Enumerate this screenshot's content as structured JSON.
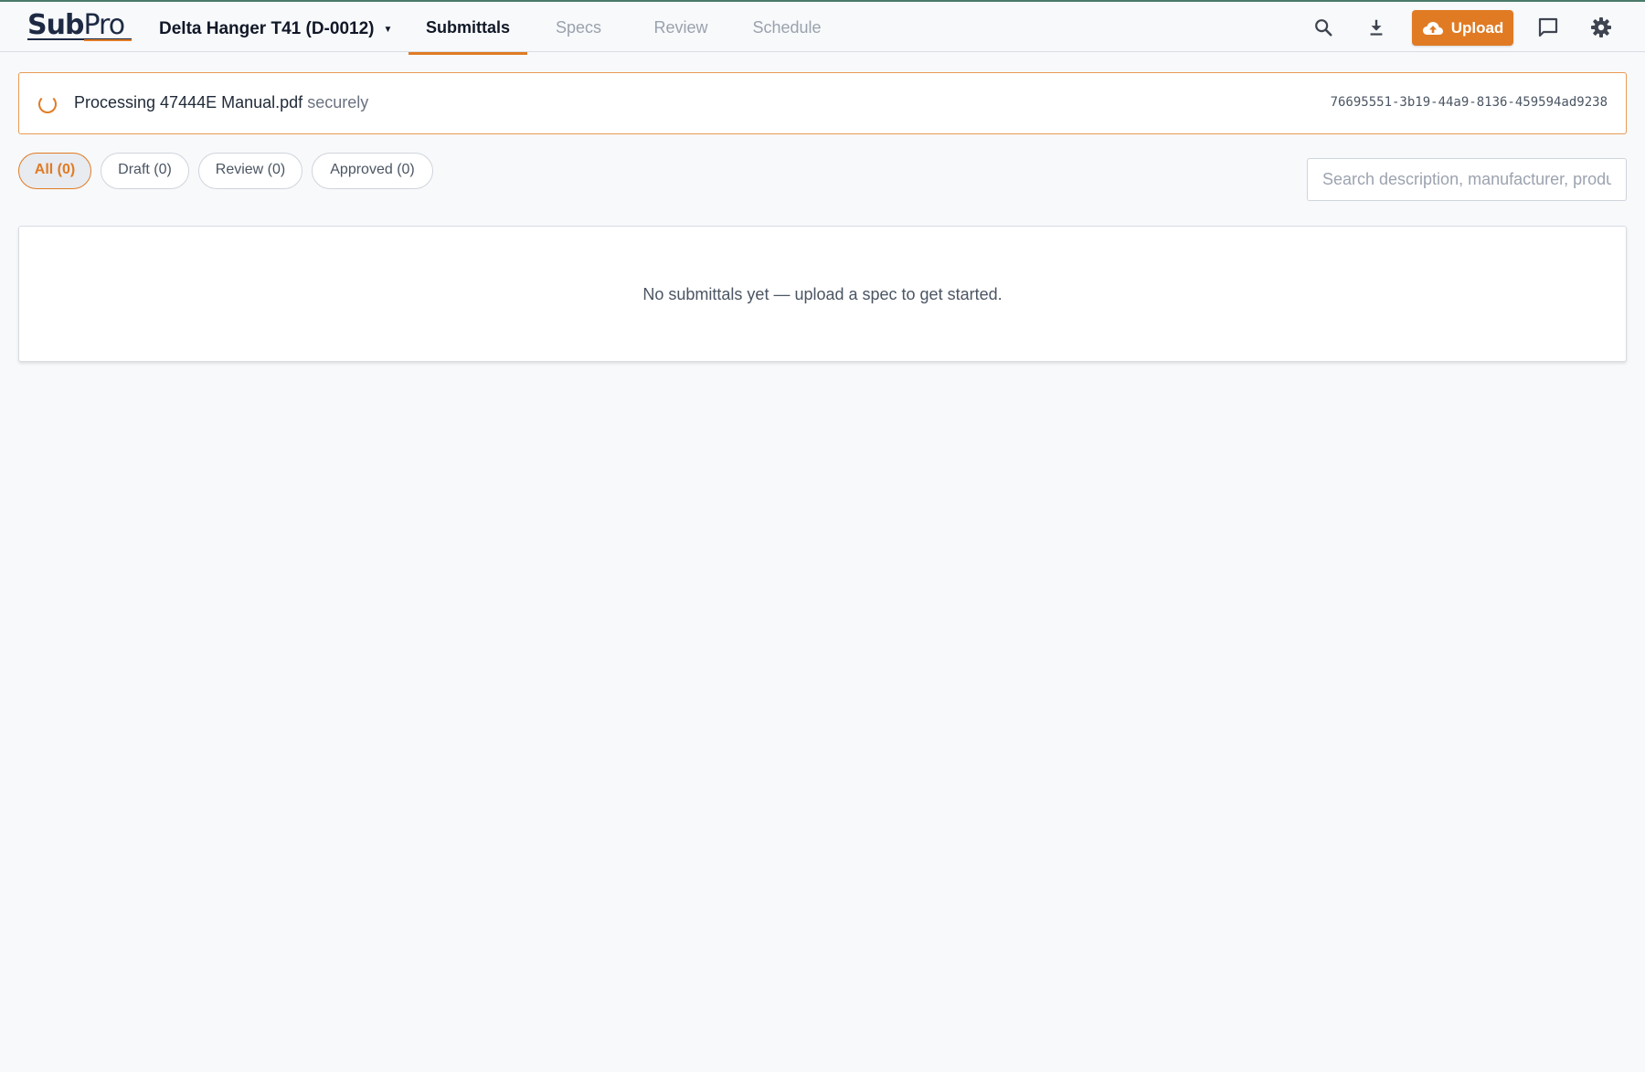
{
  "app": {
    "logo_sub": "Sub",
    "logo_pro": "Pro",
    "project": "Delta Hanger T41 (D-0012)"
  },
  "tabs": [
    {
      "label": "Submittals",
      "active": true
    },
    {
      "label": "Specs",
      "active": false
    },
    {
      "label": "Review",
      "active": false
    },
    {
      "label": "Schedule",
      "active": false
    }
  ],
  "toolbar": {
    "upload_label": "Upload",
    "icons": [
      "search-icon",
      "download-icon",
      "cloud-upload-icon",
      "chat-icon",
      "gear-icon"
    ]
  },
  "banner": {
    "prefix": "Processing 47444E Manual.pdf",
    "suffix": "securely",
    "job_id": "76695551-3b19-44a9-8136-459594ad9238"
  },
  "filters": [
    {
      "label": "All (0)",
      "active": true
    },
    {
      "label": "Draft (0)",
      "active": false
    },
    {
      "label": "Review (0)",
      "active": false
    },
    {
      "label": "Approved (0)",
      "active": false
    }
  ],
  "search": {
    "placeholder": "Search description, manufacturer, product…",
    "value": ""
  },
  "empty_state": {
    "message": "No submittals yet — upload a spec to get started."
  },
  "colors": {
    "accent": "#e07b24",
    "brand_navy": "#1e2a44",
    "top_stripe": "#4b7a6a"
  }
}
